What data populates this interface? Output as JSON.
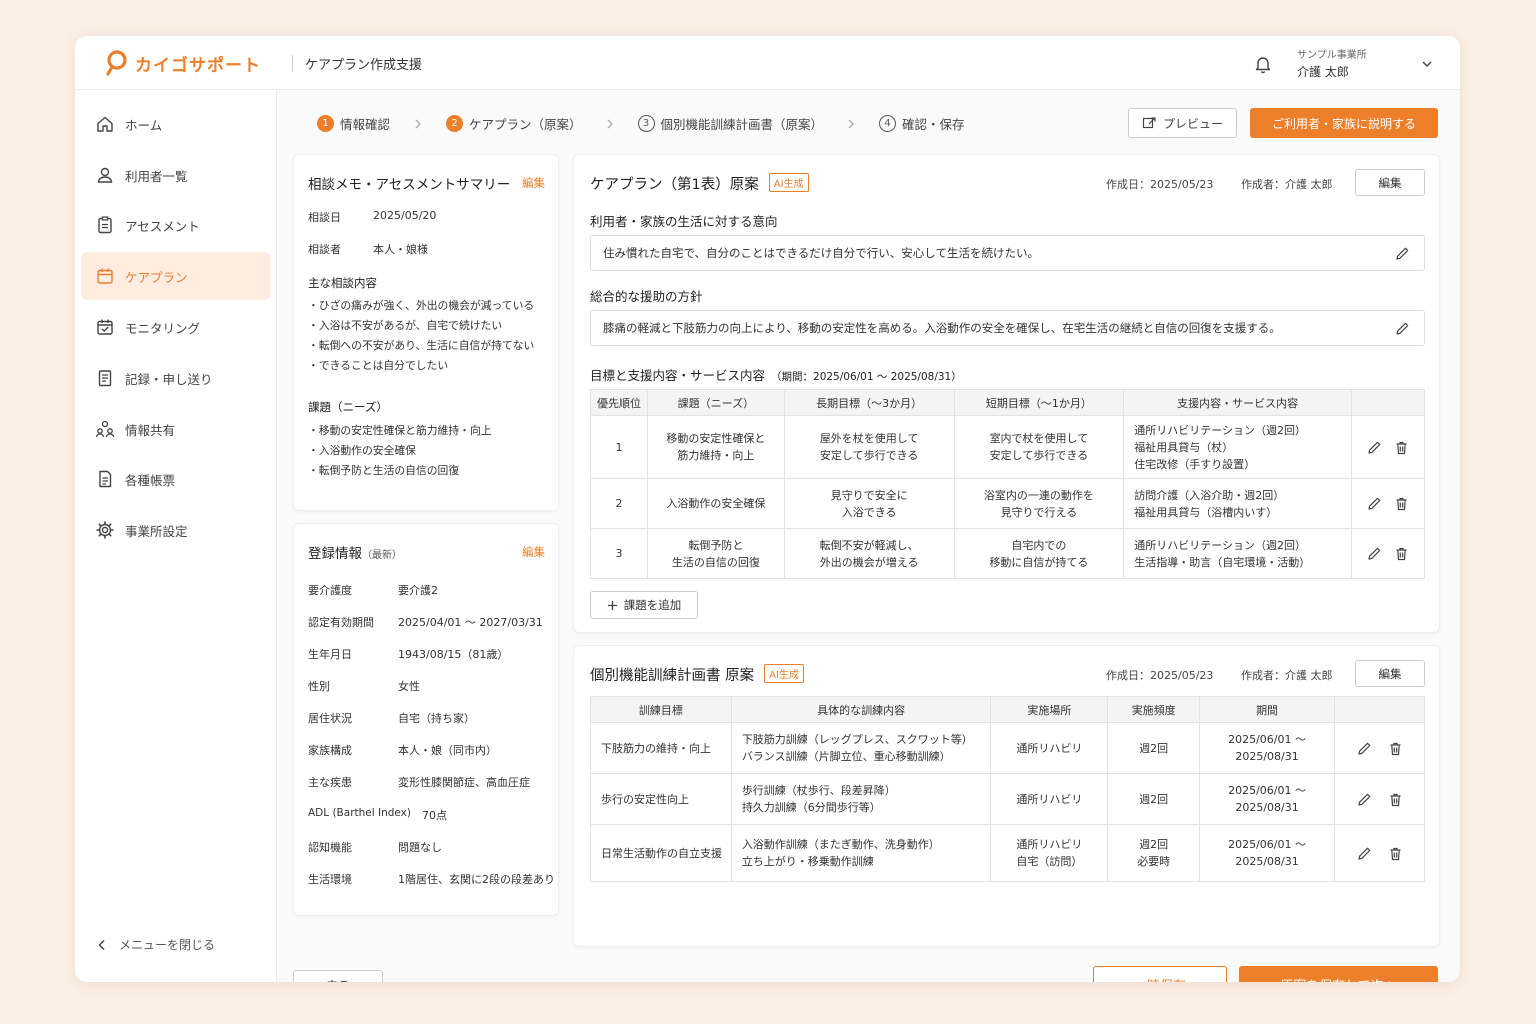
{
  "app": {
    "brand": "カイゴサポート",
    "title": "ケアプラン作成支援",
    "org": "サンプル事業所",
    "user": "介護 太郎"
  },
  "nav": {
    "items": [
      {
        "label": "ホーム",
        "icon": "home-icon"
      },
      {
        "label": "利用者一覧",
        "icon": "user-icon"
      },
      {
        "label": "アセスメント",
        "icon": "clipboard-icon"
      },
      {
        "label": "ケアプラン",
        "icon": "calendar-icon"
      },
      {
        "label": "モニタリング",
        "icon": "calendar-check-icon"
      },
      {
        "label": "記録・申し送り",
        "icon": "document-icon"
      },
      {
        "label": "情報共有",
        "icon": "people-icon"
      },
      {
        "label": "各種帳票",
        "icon": "forms-icon"
      },
      {
        "label": "事業所設定",
        "icon": "gear-icon"
      }
    ],
    "active_index": 3,
    "close_label": "メニューを閉じる"
  },
  "steps": [
    {
      "num": "1",
      "label": "情報確認",
      "state": "done"
    },
    {
      "num": "2",
      "label": "ケアプラン（原案）",
      "state": "done"
    },
    {
      "num": "3",
      "label": "個別機能訓練計画書（原案）",
      "state": "pending"
    },
    {
      "num": "4",
      "label": "確認・保存",
      "state": "pending"
    }
  ],
  "toolbar": {
    "preview_label": "プレビュー",
    "explain_label": "ご利用者・家族に説明する"
  },
  "memo": {
    "title": "相談メモ・アセスメントサマリー",
    "edit": "編集",
    "date_label": "相談日",
    "date_value": "2025/05/20",
    "person_label": "相談者",
    "person_value": "本人・娘様",
    "content_label": "主な相談内容",
    "content_items": [
      "ひざの痛みが強く、外出の機会が減っている",
      "入浴は不安があるが、自宅で続けたい",
      "転倒への不安があり、生活に自信が持てない",
      "できることは自分でしたい"
    ],
    "needs_label": "課題（ニーズ）",
    "needs_items": [
      "移動の安定性確保と筋力維持・向上",
      "入浴動作の安全確保",
      "転倒予防と生活の自信の回復"
    ]
  },
  "reg": {
    "title": "登録情報",
    "title_note": "（最新）",
    "edit": "編集",
    "rows": [
      {
        "k": "要介護度",
        "v": "要介護2"
      },
      {
        "k": "認定有効期間",
        "v": "2025/04/01 〜 2027/03/31"
      },
      {
        "k": "生年月日",
        "v": "1943/08/15（81歳）"
      },
      {
        "k": "性別",
        "v": "女性"
      },
      {
        "k": "居住状況",
        "v": "自宅（持ち家）"
      },
      {
        "k": "家族構成",
        "v": "本人・娘（同市内）"
      },
      {
        "k": "主な疾患",
        "v": "変形性膝関節症、高血圧症"
      },
      {
        "k": "ADL (Barthel Index)",
        "v": "70点"
      },
      {
        "k": "認知機能",
        "v": "問題なし"
      },
      {
        "k": "生活環境",
        "v": "1階居住、玄関に2段の段差あり"
      }
    ]
  },
  "careplan": {
    "title": "ケアプラン（第1表）原案",
    "ai_badge": "AI生成",
    "created": "作成日：2025/05/23",
    "author": "作成者：介護 太郎",
    "edit": "編集",
    "intent_label": "利用者・家族の生活に対する意向",
    "intent_value": "住み慣れた自宅で、自分のことはできるだけ自分で行い、安心して生活を続けたい。",
    "policy_label": "総合的な援助の方針",
    "policy_value": "膝痛の軽減と下肢筋力の向上により、移動の安定性を高める。入浴動作の安全を確保し、在宅生活の継続と自信の回復を支援する。",
    "goals_label": "目標と支援内容・サービス内容",
    "goals_period": "（期間：2025/06/01 〜 2025/08/31）",
    "headers": [
      "優先順位",
      "課題（ニーズ）",
      "長期目標（〜3か月）",
      "短期目標（〜1か月）",
      "支援内容・サービス内容"
    ],
    "rows": [
      {
        "priority": "1",
        "need": "移動の安定性確保と\n筋力維持・向上",
        "long": "屋外を杖を使用して\n安定して歩行できる",
        "short": "室内で杖を使用して\n安定して歩行できる",
        "service": "通所リハビリテーション（週2回）\n福祉用具貸与（杖）\n住宅改修（手すり設置）"
      },
      {
        "priority": "2",
        "need": "入浴動作の安全確保",
        "long": "見守りで安全に\n入浴できる",
        "short": "浴室内の一連の動作を\n見守りで行える",
        "service": "訪問介護（入浴介助・週2回）\n福祉用具貸与（浴槽内いす）"
      },
      {
        "priority": "3",
        "need": "転倒予防と\n生活の自信の回復",
        "long": "転倒不安が軽減し、\n外出の機会が増える",
        "short": "自宅内での\n移動に自信が持てる",
        "service": "通所リハビリテーション（週2回）\n生活指導・助言（自宅環境・活動）"
      }
    ],
    "add_label": "課題を追加"
  },
  "training": {
    "title": "個別機能訓練計画書 原案",
    "ai_badge": "AI生成",
    "created": "作成日：2025/05/23",
    "author": "作成者：介護 太郎",
    "edit": "編集",
    "headers": [
      "訓練目標",
      "具体的な訓練内容",
      "実施場所",
      "実施頻度",
      "期間"
    ],
    "rows": [
      {
        "goal": "下肢筋力の維持・向上",
        "content": "下肢筋力訓練（レッグプレス、スクワット等）\nバランス訓練（片脚立位、重心移動訓練）",
        "place": "通所リハビリ",
        "freq": "週2回",
        "period": "2025/06/01 〜\n2025/08/31"
      },
      {
        "goal": "歩行の安定性向上",
        "content": "歩行訓練（杖歩行、段差昇降）\n持久力訓練（6分間歩行等）",
        "place": "通所リハビリ",
        "freq": "週2回",
        "period": "2025/06/01 〜\n2025/08/31"
      },
      {
        "goal": "日常生活動作の自立支援",
        "content": "入浴動作訓練（またぎ動作、洗身動作）\n立ち上がり・移乗動作訓練",
        "place": "通所リハビリ\n自宅（訪問）",
        "freq": "週2回\n必要時",
        "period": "2025/06/01 〜\n2025/08/31"
      }
    ]
  },
  "footer": {
    "back": "戻る",
    "temp_save": "一時保存",
    "save_next": "原案を保存して次へ"
  },
  "colors": {
    "accent": "#ed7f2b",
    "background": "#fbf0e6",
    "active_nav": "#fdecdf"
  }
}
